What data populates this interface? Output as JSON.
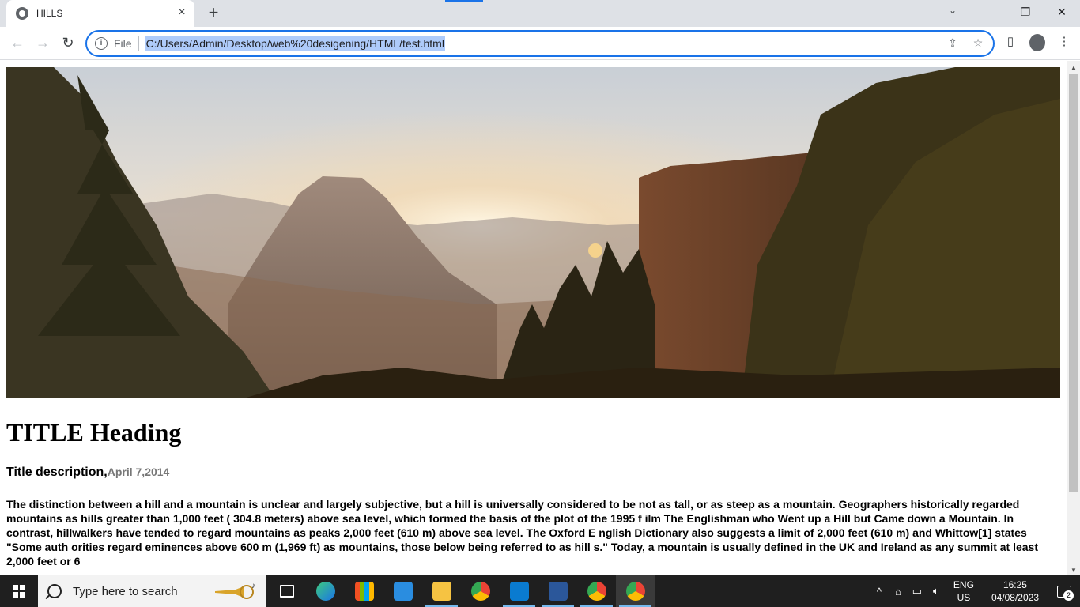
{
  "browser": {
    "tab_title": "HILLS",
    "address_scheme_label": "File",
    "url": "C:/Users/Admin/Desktop/web%20desigening/HTML/test.html"
  },
  "page": {
    "heading": "TITLE Heading",
    "description": "Title description,",
    "date": "April 7,2014",
    "body": "The distinction between a hill and a mountain is unclear and largely subjective, but a hill is universally considered to be not as tall, or as steep as a mountain. Geographers historically regarded mountains as hills greater than 1,000 feet ( 304.8 meters) above sea level, which formed the basis of the plot of the 1995 f ilm The Englishman who Went up a Hill but Came down a Mountain. In contrast, hillwalkers have tended to regard mountains as peaks 2,000 feet (610 m) above sea level. The Oxford E nglish Dictionary also suggests a limit of 2,000 feet (610 m) and Whittow[1] states \"Some auth orities regard eminences above 600 m (1,969 ft) as mountains, those below being referred to as hill s.\" Today, a mountain is usually defined in the UK and Ireland as any summit at least 2,000 feet or 6"
  },
  "taskbar": {
    "search_placeholder": "Type here to search",
    "lang_top": "ENG",
    "lang_bottom": "US",
    "time": "16:25",
    "date": "04/08/2023",
    "notification_count": "2",
    "apps": [
      "task-view",
      "edge",
      "microsoft-store",
      "mail",
      "file-explorer",
      "chrome",
      "vscode",
      "word",
      "chrome",
      "chrome"
    ]
  },
  "colors": {
    "accent": "#1a73e8",
    "url_highlight": "#aecbfa",
    "taskbar": "#1f1f1f"
  }
}
